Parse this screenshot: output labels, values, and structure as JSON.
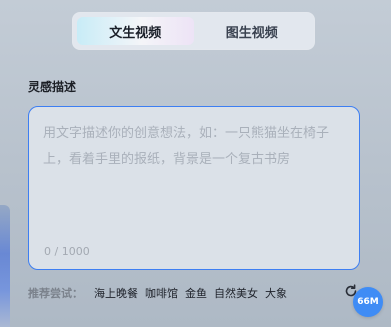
{
  "tabs": [
    {
      "label": "文生视频",
      "active": true
    },
    {
      "label": "图生视频",
      "active": false
    }
  ],
  "prompt": {
    "title": "灵感描述",
    "placeholder": "用文字描述你的创意想法，如：一只熊猫坐在椅子上，看着手里的报纸，背景是一个复古书房",
    "value": "",
    "counter": "0 / 1000"
  },
  "suggestions": {
    "label": "推荐尝试：",
    "items": [
      "海上晚餐",
      "咖啡馆",
      "金鱼",
      "自然美女",
      "大象"
    ]
  },
  "badge": {
    "text": "66M"
  },
  "colors": {
    "accent": "#3d7ef2",
    "badge": "#3f8cf5"
  },
  "icons": {
    "refresh": "refresh-icon"
  }
}
